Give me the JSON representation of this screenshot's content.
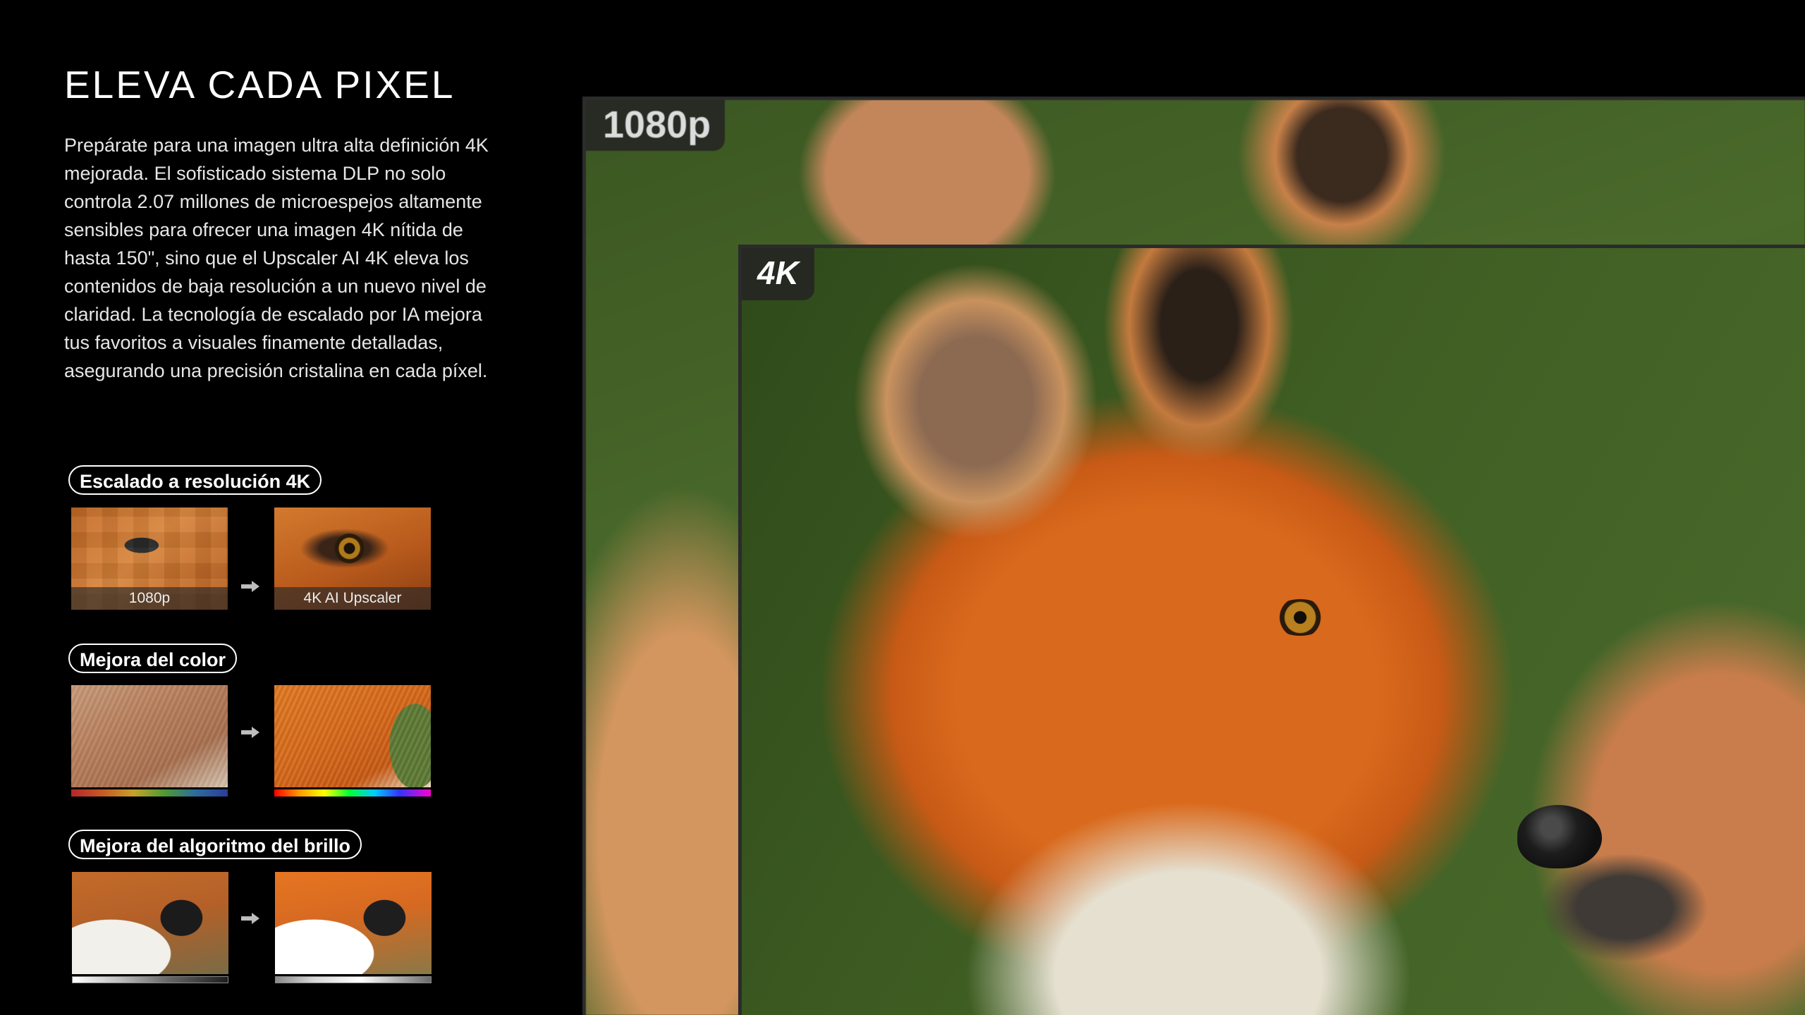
{
  "intro": {
    "title": "ELEVA CADA PIXEL",
    "description": "Prepárate para una imagen ultra alta definición 4K mejorada. El sofisticado sistema DLP no solo controla 2.07 millones de microespejos altamente sensibles para ofrecer una imagen 4K nítida de hasta 150\", sino que el Upscaler AI 4K eleva los contenidos de baja resolución a un nuevo nivel de claridad. La tecnología de escalado por IA mejora tus favoritos a visuales finamente detalladas, asegurando una precisión cristalina en cada píxel."
  },
  "features": [
    {
      "label": "Escalado a resolución 4K",
      "before_caption": "1080p",
      "after_caption": "4K AI Upscaler"
    },
    {
      "label": "Mejora del color",
      "before_bar": "narrow-spectrum",
      "after_bar": "full-spectrum"
    },
    {
      "label": "Mejora del algoritmo del brillo",
      "before_bar": "limited-range",
      "after_bar": "extended-range"
    }
  ],
  "hero": {
    "badge_back": "1080p",
    "badge_front": "4K"
  },
  "colors": {
    "background": "#000000",
    "text": "#ffffff",
    "badge_bg": "#232323"
  },
  "icons": {
    "arrow": "arrow-right-icon"
  }
}
